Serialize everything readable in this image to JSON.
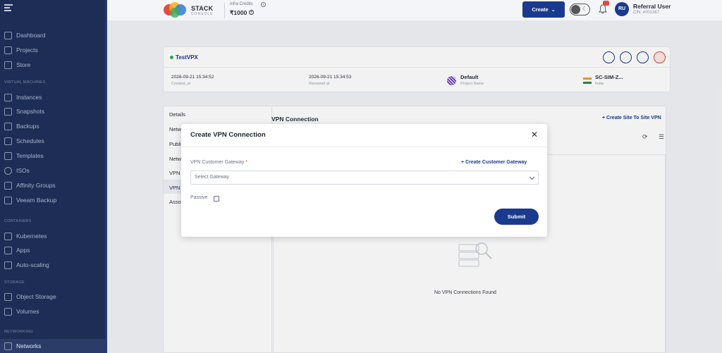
{
  "sidebar": {
    "items": [
      {
        "label": "Dashboard",
        "icon": "home-icon"
      },
      {
        "label": "Projects",
        "icon": "cube-icon"
      },
      {
        "label": "Store",
        "icon": "cart-icon"
      },
      {
        "label": "Instances",
        "icon": "instance-icon"
      },
      {
        "label": "Snapshots",
        "icon": "camera-icon"
      },
      {
        "label": "Backups",
        "icon": "backup-icon"
      },
      {
        "label": "Schedules",
        "icon": "calendar-icon"
      },
      {
        "label": "Templates",
        "icon": "template-icon"
      },
      {
        "label": "ISOs",
        "icon": "disc-icon"
      },
      {
        "label": "Affinity Groups",
        "icon": "affinity-icon"
      },
      {
        "label": "Veeam Backup",
        "icon": "veeam-icon"
      },
      {
        "label": "Kubernetes",
        "icon": "kubernetes-icon"
      },
      {
        "label": "Apps",
        "icon": "apps-icon"
      },
      {
        "label": "Auto-scaling",
        "icon": "autoscale-icon"
      },
      {
        "label": "Object Storage",
        "icon": "storage-icon"
      },
      {
        "label": "Volumes",
        "icon": "volume-icon"
      },
      {
        "label": "Networks",
        "icon": "network-icon"
      }
    ],
    "sections": {
      "virtual_machines": "VIRTUAL MACHINES",
      "containers": "CONTAINERS",
      "storage": "STORAGE",
      "networking": "NETWORKING"
    }
  },
  "header": {
    "logo_text": "STACK",
    "logo_sub": "CONSOLE",
    "credits_label": "Infra Credits",
    "credits_value": "₹1000",
    "create_label": "Create",
    "notification_count": "",
    "avatar_initials": "RU",
    "user_name": "Referral User",
    "user_cin": "CIN: #001367"
  },
  "vpc": {
    "name": "TestVPX",
    "created_value": "2026-09-21 15:34:52",
    "created_label": "Created_at",
    "renewed_value": "2026-09-21 15:34:53",
    "renewed_label": "Renewed at",
    "project_value": "Default",
    "project_label": "Project Name",
    "region_value": "SC-SIM-Z...",
    "region_label": "India"
  },
  "tabs": {
    "items": [
      "Details",
      "Netw",
      "Publi",
      "Netw",
      "VPN",
      "VPN",
      "Asso"
    ]
  },
  "vpn_panel": {
    "title": "VPN Connection",
    "create_site_link": "+ Create Site To Site VPN",
    "empty_text": "No VPN Connections Found"
  },
  "modal": {
    "title": "Create VPN Connection",
    "gateway_label": "VPN Customer Gateway",
    "required_mark": "*",
    "create_gateway_link": "+ Create Customer Gateway",
    "select_placeholder": "Select Gateway",
    "passive_label": "Passive",
    "submit_label": "Submit"
  },
  "colors": {
    "sidebar_bg": "#1d2d55",
    "primary": "#1a3a8e",
    "status_active": "#2fae52",
    "danger": "#d64a3e"
  }
}
